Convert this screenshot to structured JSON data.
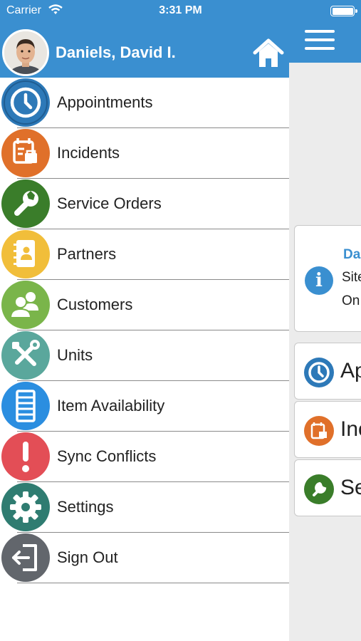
{
  "status_bar": {
    "carrier": "Carrier",
    "time": "3:31 PM"
  },
  "user": {
    "name": "Daniels, David I."
  },
  "menu": {
    "items": [
      {
        "label": "Appointments",
        "icon": "clock-icon",
        "color": "#2d79b8"
      },
      {
        "label": "Incidents",
        "icon": "calendar-icon",
        "color": "#e0702a"
      },
      {
        "label": "Service Orders",
        "icon": "wrench-icon",
        "color": "#3a7d2a"
      },
      {
        "label": "Partners",
        "icon": "address-book-icon",
        "color": "#f1be3a"
      },
      {
        "label": "Customers",
        "icon": "users-icon",
        "color": "#7ab54a"
      },
      {
        "label": "Units",
        "icon": "tools-icon",
        "color": "#5aa79c"
      },
      {
        "label": "Item Availability",
        "icon": "list-icon",
        "color": "#2b8ee0"
      },
      {
        "label": "Sync Conflicts",
        "icon": "exclamation-icon",
        "color": "#e34e56"
      },
      {
        "label": "Settings",
        "icon": "gear-icon",
        "color": "#2f7c71"
      },
      {
        "label": "Sign Out",
        "icon": "sign-out-icon",
        "color": "#62666c"
      }
    ]
  },
  "main": {
    "info_card": {
      "title": "Da",
      "line1": "Site",
      "line2": "On"
    },
    "tiles": [
      {
        "label": "Ap",
        "icon": "clock-icon",
        "color": "#2d79b8"
      },
      {
        "label": "Inc",
        "icon": "calendar-icon",
        "color": "#e0702a"
      },
      {
        "label": "Se",
        "icon": "wrench-icon",
        "color": "#3a7d2a"
      }
    ]
  },
  "colors": {
    "header_blue": "#3a8fd0",
    "background": "#ececec"
  }
}
